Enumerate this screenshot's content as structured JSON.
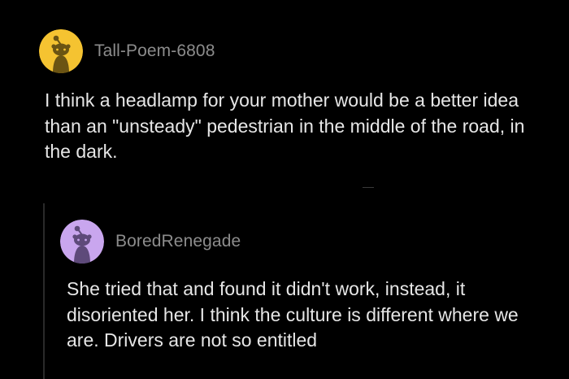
{
  "comments": [
    {
      "username": "Tall-Poem-6808",
      "avatar_icon": "snoo-avatar-icon",
      "avatar_color": "#f5c331",
      "body": "I think a headlamp for your mother would be a better idea than an \"unsteady\" pedestrian in the middle of the road, in the dark."
    },
    {
      "username": "BoredRenegade",
      "avatar_icon": "snoo-avatar-icon",
      "avatar_color": "#c9a6ee",
      "body": "She tried that and found it didn't work, instead, it disoriented her. I think the culture is different where we are. Drivers are not so entitled"
    }
  ],
  "theme": {
    "background": "#000000",
    "text": "#e6e6e6",
    "username": "#8c8c8c"
  }
}
